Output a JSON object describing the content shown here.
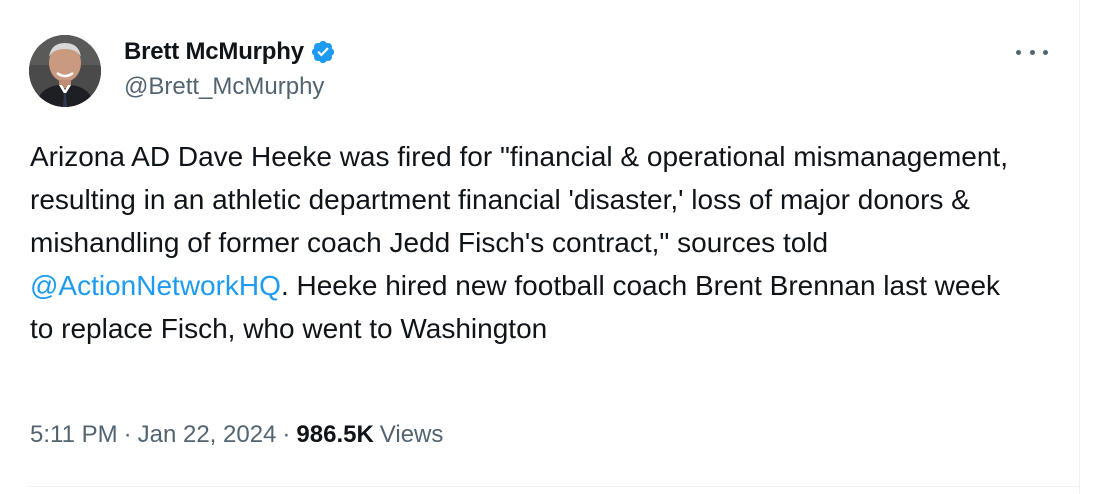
{
  "author": {
    "name": "Brett McMurphy",
    "handle": "@Brett_McMurphy",
    "verified": true,
    "verified_color": "#1d9bf0"
  },
  "tweet": {
    "text_before": "Arizona AD Dave Heeke was fired for \"financial & operational mismanagement, resulting in an athletic department financial 'disaster,' loss of major donors & mishandling of former coach Jedd Fisch's contract,\" sources told ",
    "mention": "@ActionNetworkHQ",
    "text_after": ". Heeke hired new football coach Brent Brennan last week to replace Fisch, who went to Washington"
  },
  "meta": {
    "time": "5:11 PM",
    "separator": "·",
    "date": "Jan 22, 2024",
    "views_count": "986.5K",
    "views_label": "Views"
  },
  "icons": {
    "more": "more-horizontal-icon",
    "verified": "verified-badge-icon"
  },
  "colors": {
    "text": "#0f1419",
    "secondary": "#536471",
    "link": "#1d9bf0"
  }
}
